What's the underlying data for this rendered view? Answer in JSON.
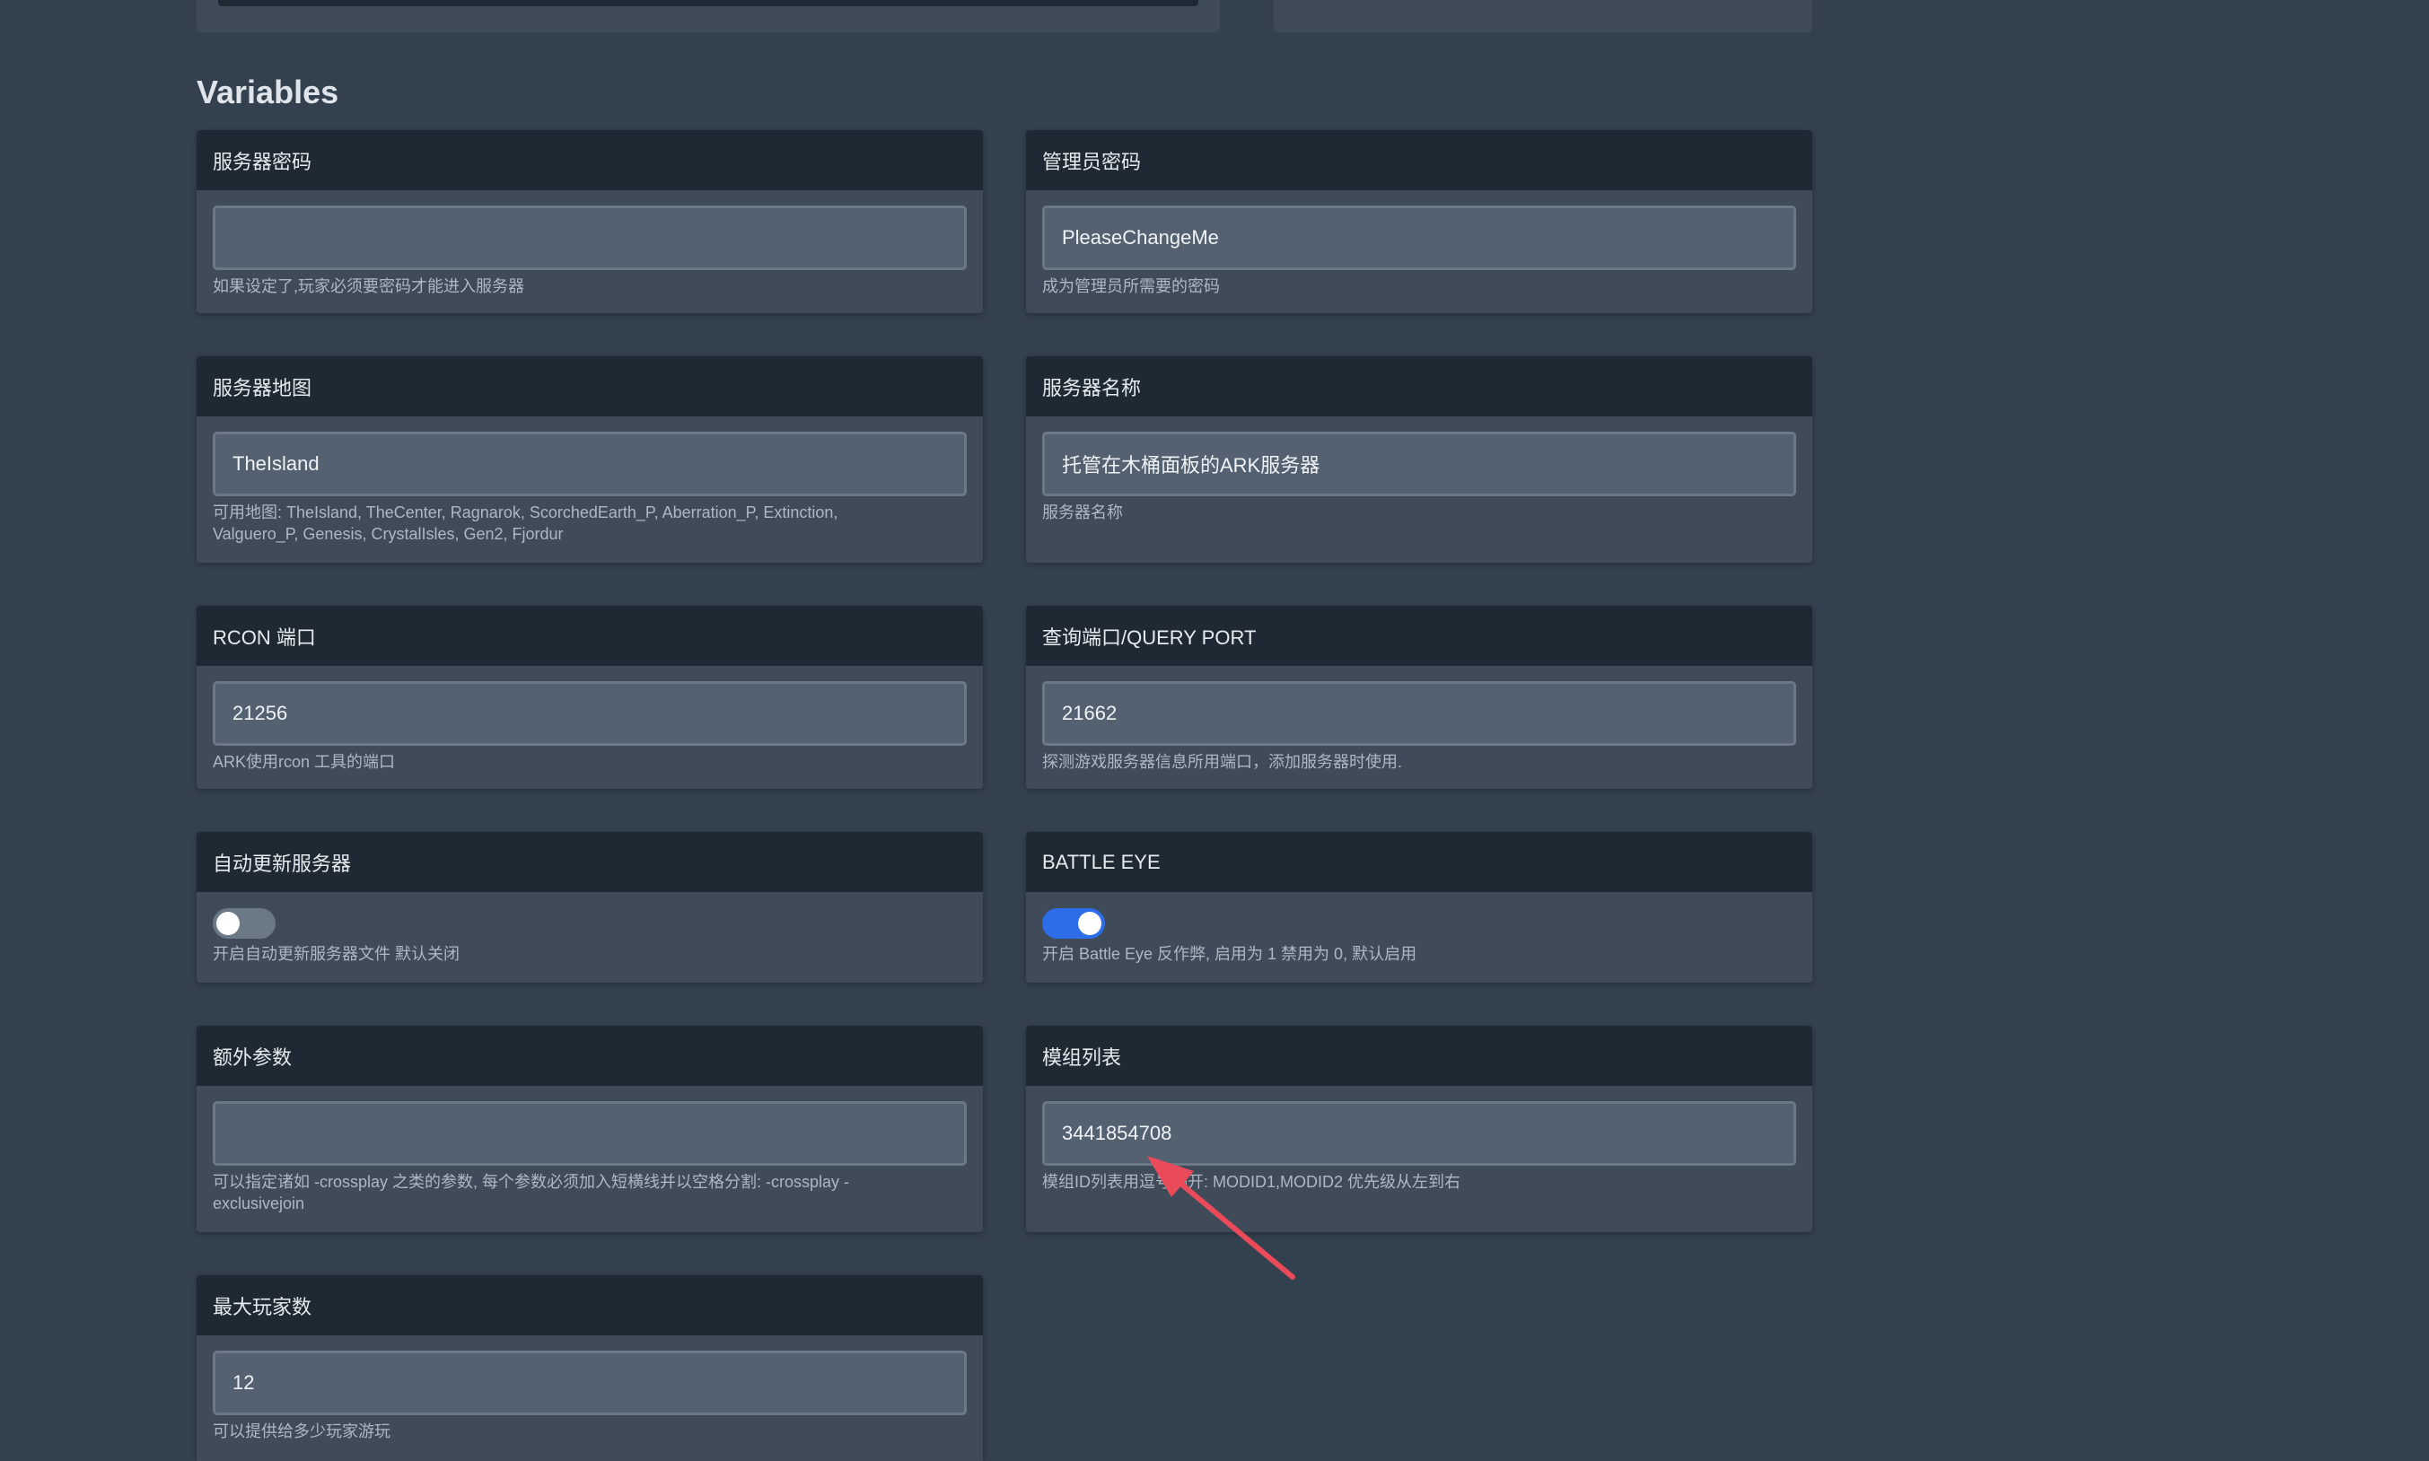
{
  "section_title": "Variables",
  "accent_colors": {
    "toggle_on": "#2e6de8",
    "annotation_arrow": "#ea4a5a"
  },
  "cards": {
    "server_password": {
      "title": "服务器密码",
      "value": "",
      "help": "如果设定了,玩家必须要密码才能进入服务器"
    },
    "admin_password": {
      "title": "管理员密码",
      "value": "PleaseChangeMe",
      "help": "成为管理员所需要的密码"
    },
    "server_map": {
      "title": "服务器地图",
      "value": "TheIsland",
      "help": "可用地图: TheIsland, TheCenter, Ragnarok, ScorchedEarth_P, Aberration_P, Extinction, Valguero_P, Genesis, CrystalIsles, Gen2, Fjordur"
    },
    "server_name": {
      "title": "服务器名称",
      "value": "托管在木桶面板的ARK服务器",
      "help": "服务器名称"
    },
    "rcon_port": {
      "title": "RCON 端口",
      "value": "21256",
      "help": "ARK使用rcon 工具的端口"
    },
    "query_port": {
      "title": "查询端口/QUERY PORT",
      "value": "21662",
      "help": "探测游戏服务器信息所用端口，添加服务器时使用."
    },
    "auto_update": {
      "title": "自动更新服务器",
      "state": "off",
      "help": "开启自动更新服务器文件 默认关闭"
    },
    "battle_eye": {
      "title": "BATTLE EYE",
      "state": "on",
      "help": "开启 Battle Eye 反作弊, 启用为 1 禁用为 0, 默认启用"
    },
    "extra_args": {
      "title": "额外参数",
      "value": "",
      "help": "可以指定诸如 -crossplay 之类的参数, 每个参数必须加入短横线并以空格分割: -crossplay -exclusivejoin"
    },
    "mod_list": {
      "title": "模组列表",
      "value": "3441854708",
      "help": "模组ID列表用逗号隔开: MODID1,MODID2 优先级从左到右"
    },
    "max_players": {
      "title": "最大玩家数",
      "value": "12",
      "help": "可以提供给多少玩家游玩"
    }
  }
}
